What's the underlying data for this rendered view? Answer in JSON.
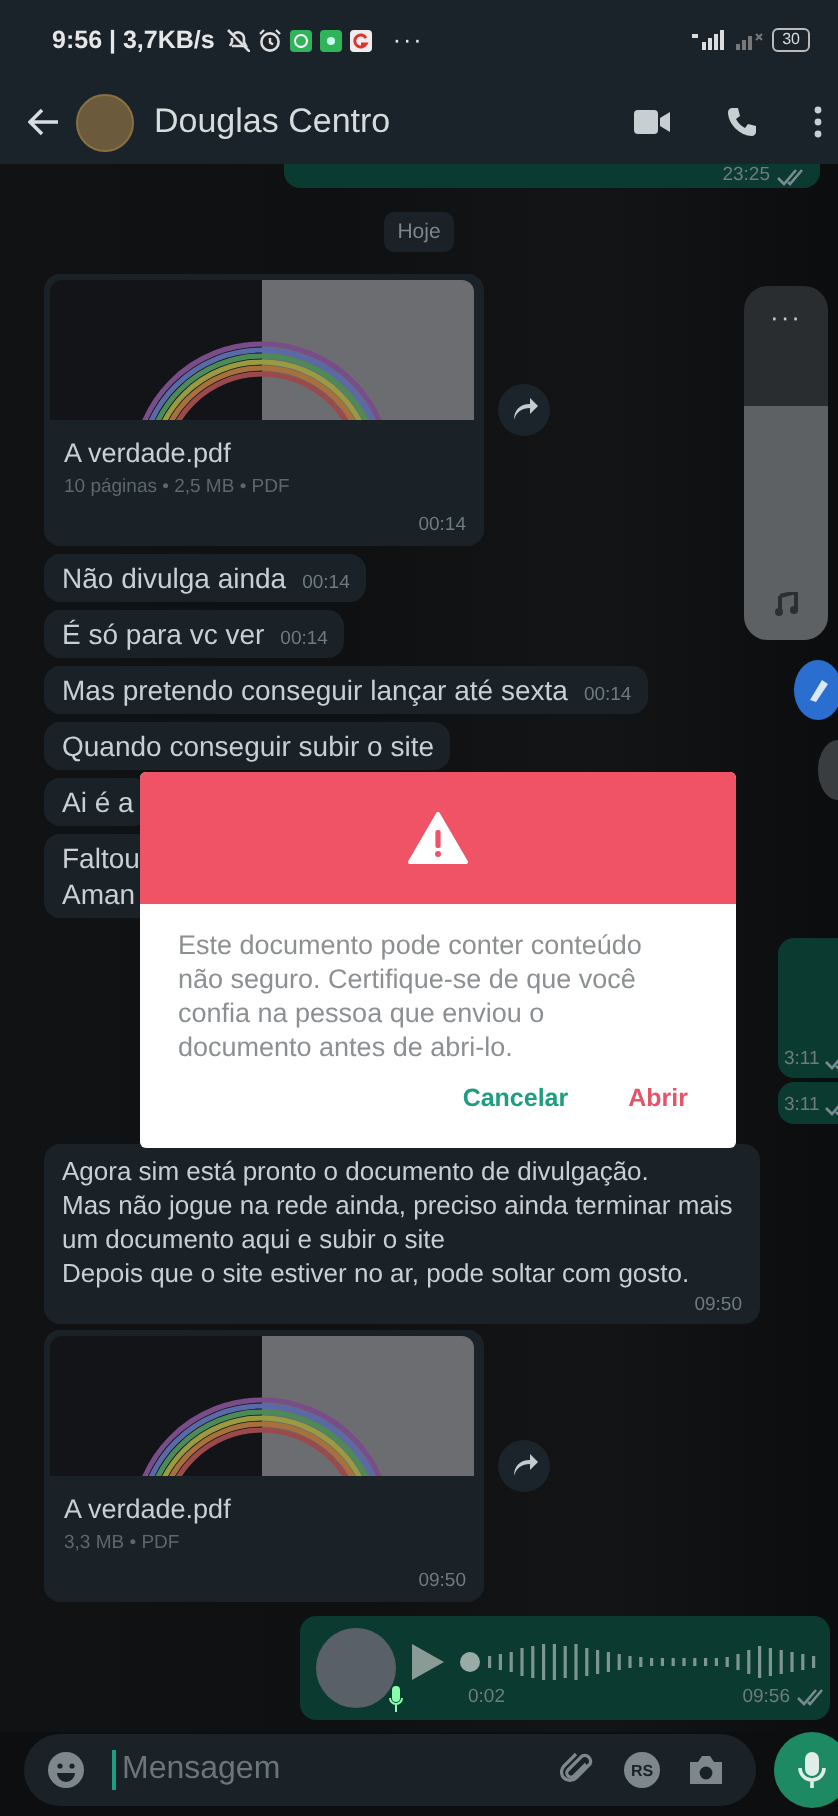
{
  "status_bar": {
    "text": "9:56 | 3,7KB/s",
    "more": "···",
    "battery": "30"
  },
  "header": {
    "title": "Douglas Centro"
  },
  "messages": [
    {
      "kind": "clipped",
      "time": "23:25"
    },
    {
      "kind": "date",
      "text": "Hoje"
    },
    {
      "kind": "document",
      "name": "A verdade.pdf",
      "meta": "10 páginas • 2,5 MB • PDF",
      "time": "00:14"
    },
    {
      "kind": "text",
      "text": "Não divulga ainda",
      "time": "00:14"
    },
    {
      "kind": "text",
      "text": "É só para vc ver",
      "time": "00:14"
    },
    {
      "kind": "text",
      "text": "Mas pretendo conseguir lançar até sexta",
      "time": "00:14"
    },
    {
      "kind": "text",
      "text": "Quando conseguir subir o site"
    },
    {
      "kind": "text",
      "text": "Ai é a"
    },
    {
      "kind": "text",
      "text": "Faltou\nAman"
    },
    {
      "kind": "outgoing_edge",
      "time": "3:11",
      "tall": true
    },
    {
      "kind": "outgoing_edge",
      "time": "3:11",
      "tall": false
    },
    {
      "kind": "text",
      "text": "Agora sim está pronto o documento de divulgação.\nMas não jogue na rede ainda, preciso ainda terminar mais um documento aqui e subir o site\nDepois que o site estiver no ar, pode soltar com gosto.",
      "time": "09:50",
      "wide": true
    },
    {
      "kind": "document",
      "name": "A verdade.pdf",
      "meta": "3,3 MB • PDF",
      "time": "09:50"
    },
    {
      "kind": "voice",
      "duration": "0:02",
      "time": "09:56"
    }
  ],
  "music_widget": {
    "more": "···",
    "level": 0.66
  },
  "dialog": {
    "message": "Este documento pode conter conteúdo não seguro. Certifique-se de que você confia na pessoa que enviou o documento antes de abri-lo.",
    "buttons": [
      {
        "label": "Cancelar",
        "kind": "cancel"
      },
      {
        "label": "Abrir",
        "kind": "confirm"
      }
    ]
  },
  "composer": {
    "placeholder": "Mensagem",
    "sticker": "RS"
  }
}
